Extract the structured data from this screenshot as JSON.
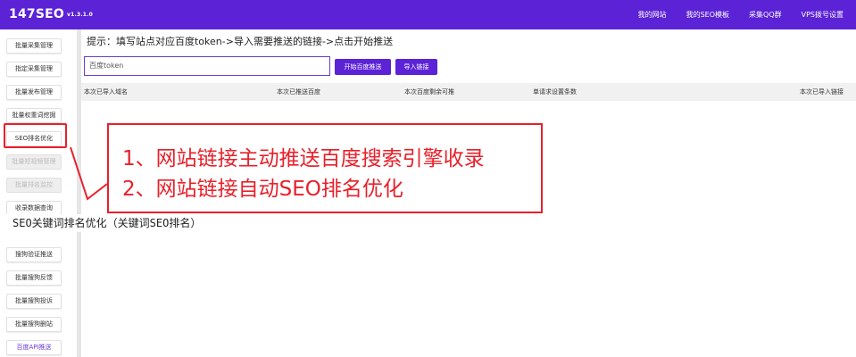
{
  "header": {
    "brand": "147SEO",
    "version": "v1.3.1.0",
    "nav": [
      "我的网站",
      "我的SEO模板",
      "采集QQ群",
      "VPS拨号设置"
    ]
  },
  "sidebar": {
    "items": [
      {
        "label": "批量采集管理",
        "state": "normal"
      },
      {
        "label": "指定采集管理",
        "state": "normal"
      },
      {
        "label": "批量发布管理",
        "state": "normal"
      },
      {
        "label": "批量权重词挖掘",
        "state": "normal"
      },
      {
        "label": "SEO排名优化",
        "state": "highlighted"
      },
      {
        "label": "批量短视频管理",
        "state": "disabled"
      },
      {
        "label": "批量排名监控",
        "state": "disabled"
      },
      {
        "label": "收录数据查询",
        "state": "normal"
      },
      {
        "label": "搜狗验证推送",
        "state": "normal"
      },
      {
        "label": "批量搜狗反馈",
        "state": "normal"
      },
      {
        "label": "批量搜狗投诉",
        "state": "normal"
      },
      {
        "label": "批量搜狗删站",
        "state": "normal"
      },
      {
        "label": "百度API推送",
        "state": "accent"
      }
    ]
  },
  "main": {
    "hint": "提示：填写站点对应百度token->导入需要推送的链接->点击开始推送",
    "token_value": "百度token",
    "token_placeholder": "百度token",
    "start_button": "开始百度推送",
    "import_button": "导入链接",
    "columns": [
      "本次已导入域名",
      "本次已推送百度",
      "本次百度剩余可推",
      "单请求设置条数",
      "本次已导入链接"
    ]
  },
  "callout": {
    "line1": "1、网站链接主动推送百度搜索引擎收录",
    "line2": "2、网站链接自动SEO排名优化"
  },
  "caption": "SEO关键词排名优化（关键词SEO排名）",
  "colors": {
    "brand_purple": "#5b22d6",
    "annotation_red": "#e8202a"
  }
}
